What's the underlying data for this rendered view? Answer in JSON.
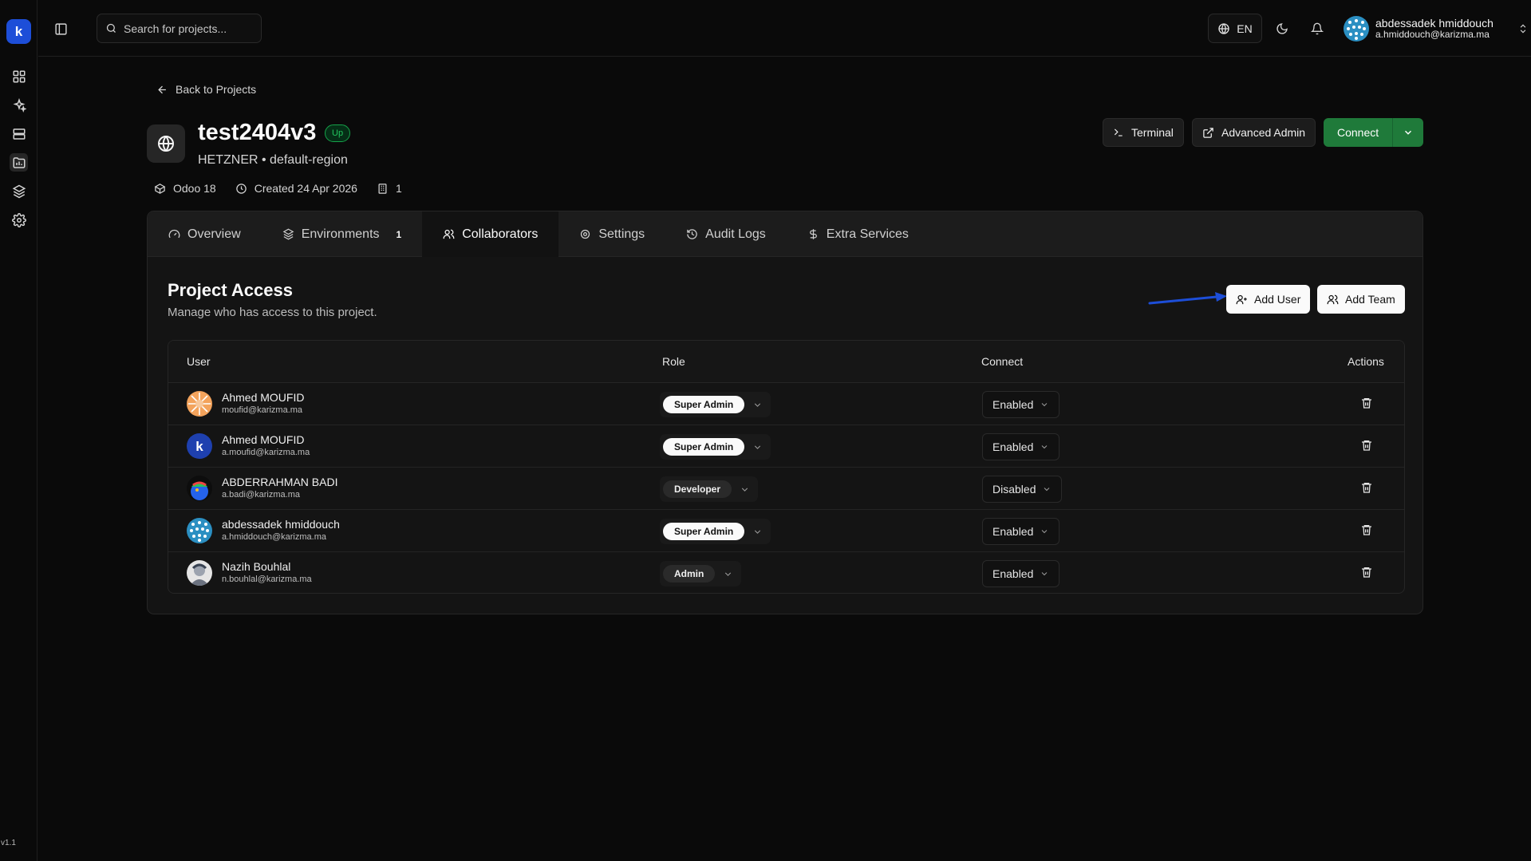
{
  "app": {
    "logo_text": "k",
    "version": "v1.1"
  },
  "header": {
    "search_placeholder": "Search for projects...",
    "language": "EN",
    "user": {
      "name": "abdessadek hmiddouch",
      "email": "a.hmiddouch@karizma.ma"
    }
  },
  "project": {
    "back_label": "Back to Projects",
    "name": "test2404v3",
    "status": "Up",
    "subtitle": "HETZNER • default-region",
    "meta": {
      "version": "Odoo 18",
      "created": "Created 24 Apr 2026",
      "count": "1"
    },
    "actions": {
      "terminal": "Terminal",
      "advanced_admin": "Advanced Admin",
      "connect": "Connect"
    }
  },
  "tabs": [
    {
      "label": "Overview",
      "icon": "gauge-icon"
    },
    {
      "label": "Environments",
      "icon": "layers-icon",
      "count": "1"
    },
    {
      "label": "Collaborators",
      "icon": "users-icon",
      "active": true
    },
    {
      "label": "Settings",
      "icon": "gear-icon"
    },
    {
      "label": "Audit Logs",
      "icon": "history-icon"
    },
    {
      "label": "Extra Services",
      "icon": "dollar-icon"
    }
  ],
  "access": {
    "title": "Project Access",
    "subtitle": "Manage who has access to this project.",
    "add_user": "Add User",
    "add_team": "Add Team",
    "columns": {
      "user": "User",
      "role": "Role",
      "connect": "Connect",
      "actions": "Actions"
    },
    "rows": [
      {
        "name": "Ahmed MOUFID",
        "email": "moufid@karizma.ma",
        "role": "Super Admin",
        "connect": "Enabled"
      },
      {
        "name": "Ahmed MOUFID",
        "email": "a.moufid@karizma.ma",
        "role": "Super Admin",
        "connect": "Enabled"
      },
      {
        "name": "ABDERRAHMAN BADI",
        "email": "a.badi@karizma.ma",
        "role": "Developer",
        "connect": "Disabled"
      },
      {
        "name": "abdessadek hmiddouch",
        "email": "a.hmiddouch@karizma.ma",
        "role": "Super Admin",
        "connect": "Enabled"
      },
      {
        "name": "Nazih Bouhlal",
        "email": "n.bouhlal@karizma.ma",
        "role": "Admin",
        "connect": "Enabled"
      }
    ]
  },
  "colors": {
    "accent_green": "#1f7a3a",
    "status_green": "#22c55e",
    "arrow_blue": "#1d4ed8",
    "background": "#0a0a0a"
  }
}
